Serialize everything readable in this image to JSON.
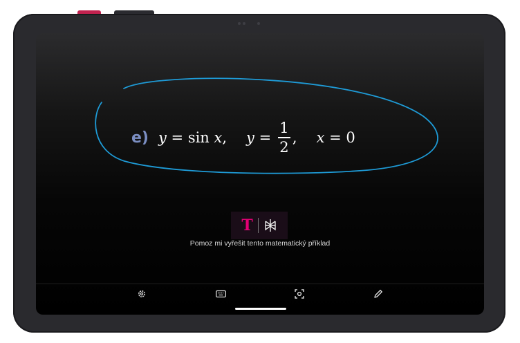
{
  "equation": {
    "letter": "e)",
    "y1": "y",
    "eq1": " = ",
    "fn": "sin ",
    "x1": "x",
    "comma1": ",",
    "y2": "y",
    "eq2": " = ",
    "numerator": "1",
    "denominator": "2",
    "comma2": ",",
    "x2": "x",
    "eq3": " = 0"
  },
  "assistant": {
    "logo_t": "T",
    "prompt": "Pomoz mi vyřešit tento matematický příklad"
  },
  "toolbar": {
    "items": [
      {
        "icon": "gear-icon"
      },
      {
        "icon": "keyboard-icon"
      },
      {
        "icon": "scan-icon"
      },
      {
        "icon": "pen-icon"
      }
    ]
  },
  "colors": {
    "ink": "#1e9bd7",
    "brand_magenta": "#e20074",
    "letter_accent": "#7b8ec2",
    "power_button": "#c2224f"
  }
}
